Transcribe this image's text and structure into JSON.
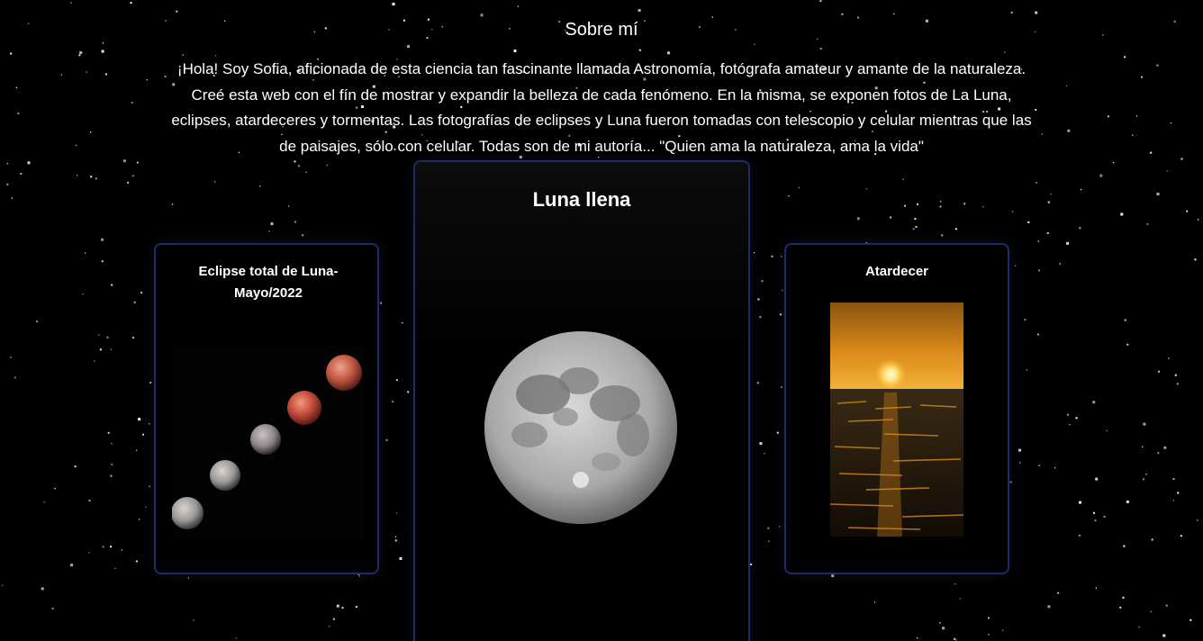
{
  "about": {
    "title": "Sobre mí",
    "text": "¡Hola! Soy Sofia, aficionada de esta ciencia tan fascinante llamada Astronomía, fotógrafa amateur y amante de la naturaleza. Creé esta web con el fín de mostrar y expandir la belleza de cada fenómeno. En la misma, se exponen fotos de La Luna, eclipses, atardeceres y tormentas. Las fotografías de eclipses y Luna fueron tomadas con telescopio y celular mientras que las de paisajes, sólo con celular. Todas son de mi autoría... \"Quien ama la naturaleza, ama la vida\""
  },
  "cards": {
    "eclipse": {
      "title": "Eclipse total de Luna-Mayo/2022"
    },
    "moon": {
      "title": "Luna llena"
    },
    "sunset": {
      "title": "Atardecer"
    }
  },
  "colors": {
    "background": "#000000",
    "card_border": "#1f2a6b",
    "text": "#ffffff"
  }
}
